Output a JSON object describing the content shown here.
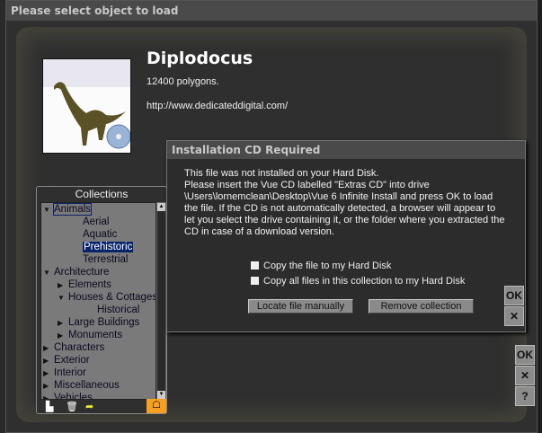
{
  "window": {
    "title": "Please select object to load"
  },
  "object": {
    "name": "Diplodocus",
    "polygons": "12400 polygons.",
    "url": "http://www.dedicateddigital.com/"
  },
  "collections": {
    "header": "Collections",
    "items": [
      {
        "label": "Animals",
        "level": 0,
        "state": "open",
        "focused": true
      },
      {
        "label": "Aerial",
        "level": 2,
        "state": "leaf"
      },
      {
        "label": "Aquatic",
        "level": 2,
        "state": "leaf"
      },
      {
        "label": "Prehistoric",
        "level": 2,
        "state": "leaf",
        "selected": true
      },
      {
        "label": "Terrestrial",
        "level": 2,
        "state": "leaf"
      },
      {
        "label": "Architecture",
        "level": 0,
        "state": "open"
      },
      {
        "label": "Elements",
        "level": 1,
        "state": "closed"
      },
      {
        "label": "Houses & Cottages",
        "level": 1,
        "state": "open"
      },
      {
        "label": "Historical",
        "level": 3,
        "state": "leaf"
      },
      {
        "label": "Large Buildings",
        "level": 1,
        "state": "closed"
      },
      {
        "label": "Monuments",
        "level": 1,
        "state": "closed"
      },
      {
        "label": "Characters",
        "level": 0,
        "state": "closed"
      },
      {
        "label": "Exterior",
        "level": 0,
        "state": "closed"
      },
      {
        "label": "Interior",
        "level": 0,
        "state": "closed"
      },
      {
        "label": "Miscellaneous",
        "level": 0,
        "state": "closed"
      },
      {
        "label": "Vehicles",
        "level": 0,
        "state": "closed"
      }
    ]
  },
  "dialog": {
    "title": "Installation CD Required",
    "message": [
      "This file was not installed on your Hard Disk.",
      "Please insert the Vue CD labelled \"Extras CD\" into drive \\Users\\lornemclean\\Desktop\\Vue 6 Infinite Install and press OK to load the file. If the CD is not automatically detected, a browser will appear to let you select the drive containing it, or the folder where you extracted the CD in case of a download version."
    ],
    "copy_file": "Copy the file to my Hard Disk",
    "copy_all": "Copy all files in this collection to my Hard Disk",
    "locate": "Locate file manually",
    "remove": "Remove collection",
    "ok": "OK",
    "cancel": "✕"
  },
  "side": {
    "ok": "OK",
    "cancel": "✕",
    "help": "?"
  }
}
